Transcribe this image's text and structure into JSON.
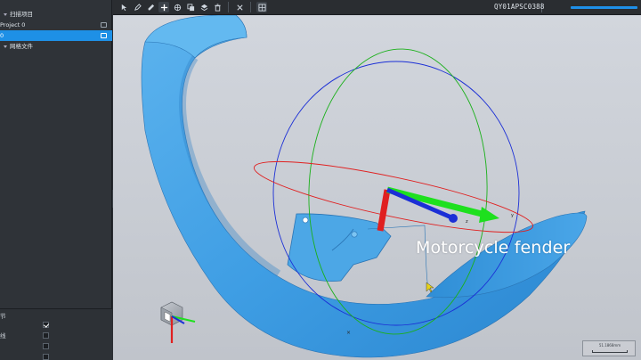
{
  "tree": {
    "items": [
      {
        "label": "扫描项目"
      },
      {
        "label": "Project 0"
      },
      {
        "label": "0"
      },
      {
        "label": "网格文件"
      }
    ]
  },
  "properties": {
    "header": "节",
    "rows": [
      {
        "label": "",
        "checked": true
      },
      {
        "label": "线",
        "checked": false
      },
      {
        "label": "",
        "checked": false
      },
      {
        "label": "",
        "checked": false
      }
    ]
  },
  "toolbar": {
    "device_id": "QY01APSC0388",
    "status_tag": "",
    "icons": [
      "select-icon",
      "pen-icon",
      "brush-icon",
      "add-point-icon",
      "transform-icon",
      "copy-icon",
      "layers-icon",
      "delete-icon",
      "close-icon",
      "grid-icon"
    ]
  },
  "viewport": {
    "caption": "Motorcycle fender",
    "axis_y_label": "y",
    "axis_z_label": "z",
    "scale_label": "51.1868mm",
    "cursor_mark": "×"
  },
  "colors": {
    "accent": "#1e90e6",
    "mesh": "#4aa3e6",
    "axis_x": "#e02020",
    "axis_y": "#1ee01e",
    "axis_z": "#1b2fd6"
  }
}
